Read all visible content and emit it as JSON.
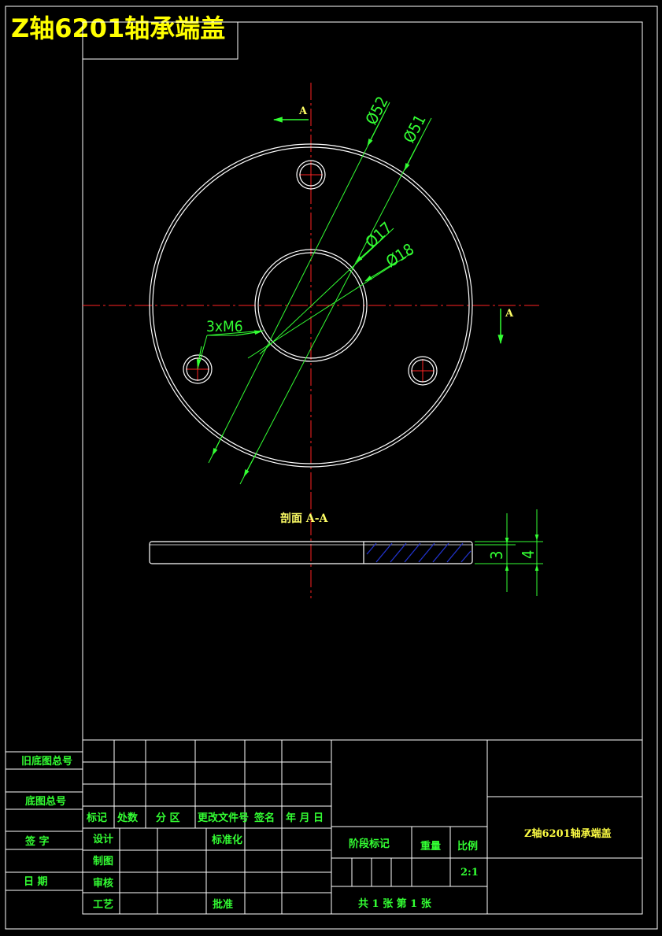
{
  "title": "Z轴6201轴承端盖",
  "view_labels": {
    "section_marker": "A",
    "section_title": "剖面 A-A"
  },
  "dimensions": {
    "d52": "Ø52",
    "d51": "Ø51",
    "d17": "Ø17",
    "d18": "Ø18",
    "holes": "3xM6",
    "t3": "3",
    "t4": "4"
  },
  "left_strip": {
    "old_base_no": "旧底图总号",
    "base_no": "底图总号",
    "signature": "签 字",
    "date": "日 期"
  },
  "title_block": {
    "headers": [
      "标记",
      "处数",
      "分 区",
      "更改文件号",
      "签名",
      "年 月 日"
    ],
    "design": "设计",
    "drafting": "制图",
    "review": "审核",
    "process": "工艺",
    "standardization": "标准化",
    "approve": "批准",
    "stage_mark": "阶段标记",
    "weight": "重量",
    "scale_label": "比例",
    "scale_value": "2:1",
    "sheets": "共 1 张 第 1 张",
    "drawing_name": "Z轴6201轴承端盖"
  },
  "colors": {
    "background": "#000000",
    "outline": "#ffffff",
    "centerline": "#ff2222",
    "dimension": "#33ff33",
    "hatch": "#2233cc",
    "title": "#ffff00"
  }
}
